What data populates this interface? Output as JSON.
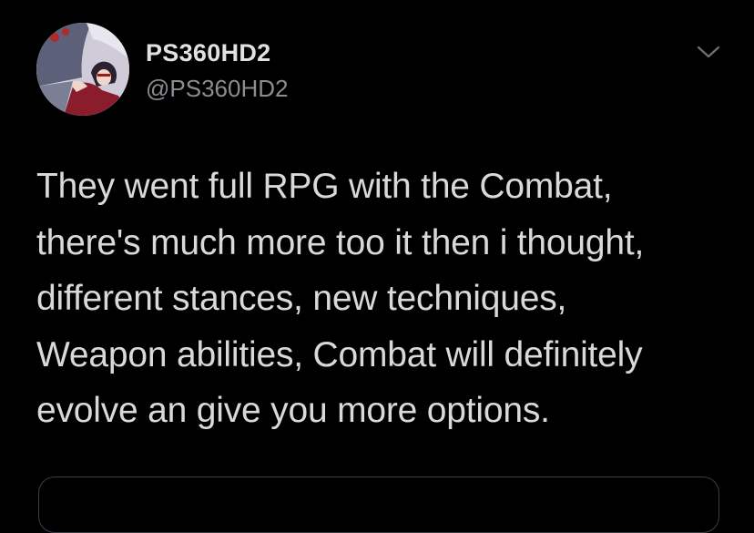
{
  "user": {
    "display_name": "PS360HD2",
    "handle": "@PS360HD2",
    "avatar_icon": "profile-avatar"
  },
  "tweet": {
    "lines": [
      "They went full RPG with the Combat,",
      "there's much more too it then i thought,",
      "different stances, new techniques,",
      "Weapon abilities, Combat will definitely",
      "evolve an give you more options."
    ]
  },
  "controls": {
    "more_icon": "chevron-down-icon"
  },
  "colors": {
    "background": "#000000",
    "text": "#d9d9d9",
    "handle": "#8a8d91",
    "border": "#3a3d41"
  }
}
